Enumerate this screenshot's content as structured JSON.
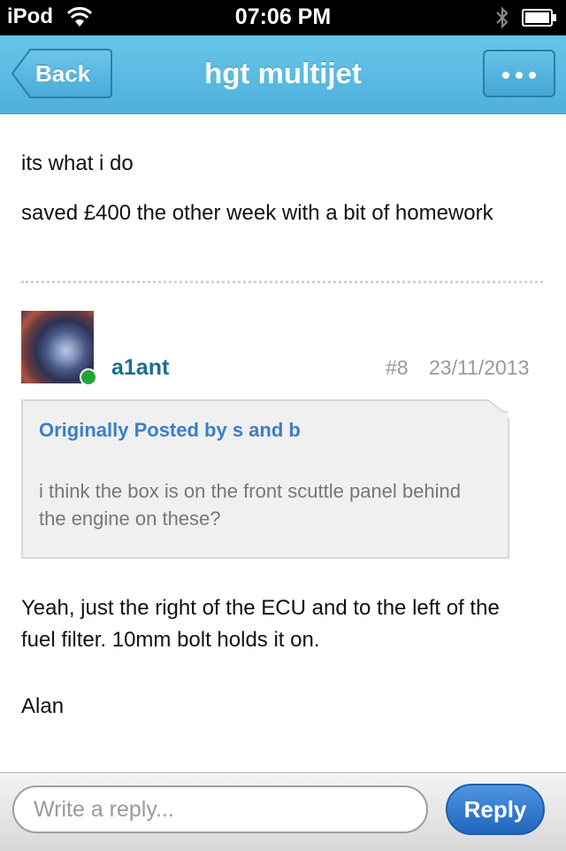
{
  "status_bar": {
    "carrier": "iPod",
    "time": "07:06 PM"
  },
  "nav": {
    "back_label": "Back",
    "title": "hgt multijet",
    "more_icon": "ellipsis-icon"
  },
  "previous_post": {
    "lines": [
      "its what i do",
      "saved £400 the other week with a bit of homework"
    ]
  },
  "post": {
    "username": "a1ant",
    "online": true,
    "number": "#8",
    "date": "23/11/2013",
    "quote": {
      "author_line": "Originally Posted by s and b",
      "text": "i think the box is on the front scuttle panel behind the engine on these?"
    },
    "body": [
      "Yeah, just the right of the ECU and to the left of the fuel filter. 10mm bolt holds it on.",
      "Alan"
    ]
  },
  "reply_bar": {
    "placeholder": "Write a reply...",
    "button_label": "Reply"
  },
  "colors": {
    "nav": "#5bbbe3",
    "username": "#1a6f8f",
    "quote_author": "#3d7ec8",
    "online": "#1fa63a",
    "reply_button": "#2f77cc"
  }
}
